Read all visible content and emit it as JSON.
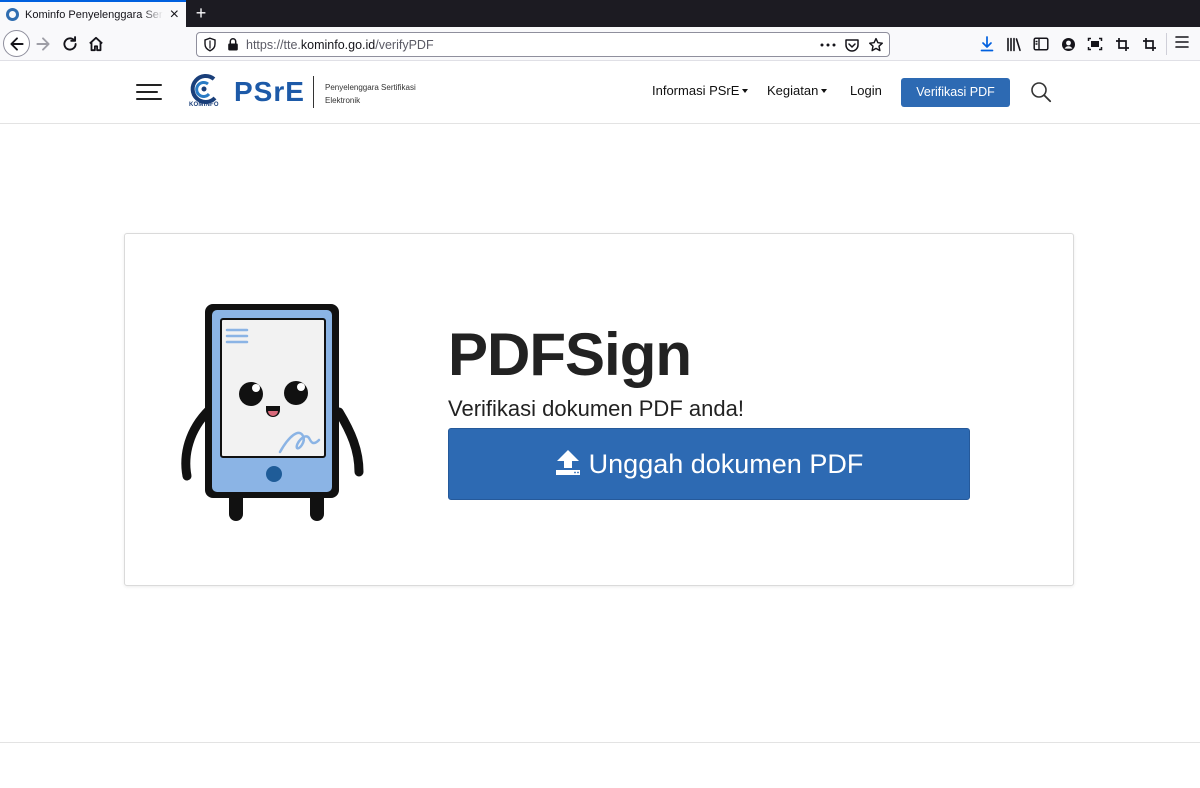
{
  "browser": {
    "tab_title": "Kominfo Penyelenggara Sertifikasi Elektronik",
    "url_prefix": "https://tte.",
    "url_domain": "kominfo.go.id",
    "url_path": "/verifyPDF"
  },
  "header": {
    "logo_kominfo": "KOMINFO",
    "logo_psre": "PSrE",
    "logo_sub_line1": "Penyelenggara Sertifikasi",
    "logo_sub_line2": "Elektronik",
    "nav": [
      {
        "label": "Informasi PSrE",
        "dropdown": true
      },
      {
        "label": "Kegiatan",
        "dropdown": true
      },
      {
        "label": "Login",
        "dropdown": false
      }
    ],
    "verify_button": "Verifikasi PDF"
  },
  "main": {
    "title": "PDFSign",
    "subtitle": "Verifikasi dokumen PDF anda!",
    "upload_button": "Unggah dokumen PDF"
  },
  "colors": {
    "brand_blue": "#2d6ab3",
    "mascot_blue": "#8bb4e5",
    "mascot_dark": "#111111"
  },
  "icons": {
    "mascot": "phone-mascot",
    "upload": "upload-icon",
    "search": "search-icon",
    "menu": "hamburger-icon"
  }
}
